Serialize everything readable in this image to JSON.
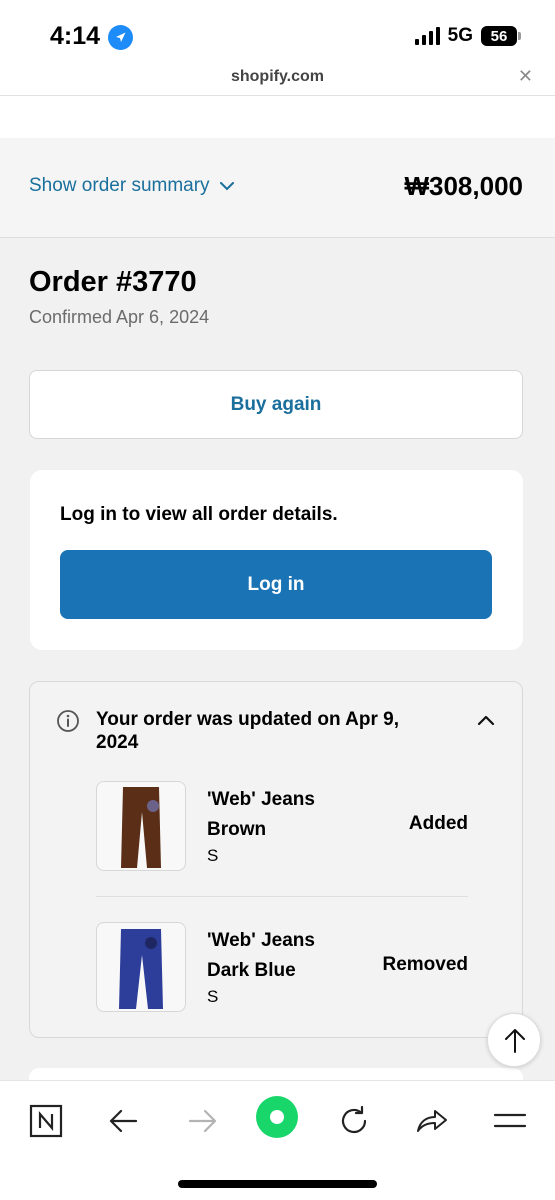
{
  "status_bar": {
    "time": "4:14",
    "network": "5G",
    "battery": "56"
  },
  "browser": {
    "url": "shopify.com"
  },
  "summary": {
    "toggle_label": "Show order summary",
    "total": "₩308,000"
  },
  "order": {
    "title": "Order #3770",
    "confirmed": "Confirmed Apr 6, 2024",
    "buy_again_label": "Buy again"
  },
  "login": {
    "message": "Log in to view all order details.",
    "button_label": "Log in"
  },
  "update": {
    "title": "Your order was updated on Apr 9, 2024",
    "items": [
      {
        "name": "'Web' Jeans Brown",
        "variant": "S",
        "status": "Added",
        "color": "#5a2e17"
      },
      {
        "name": "'Web' Jeans Dark Blue",
        "variant": "S",
        "status": "Removed",
        "color": "#2d3e9a"
      }
    ]
  },
  "colors": {
    "accent": "#1a6f9c",
    "login_button": "#1a73b5",
    "home_button": "#19d66a"
  }
}
